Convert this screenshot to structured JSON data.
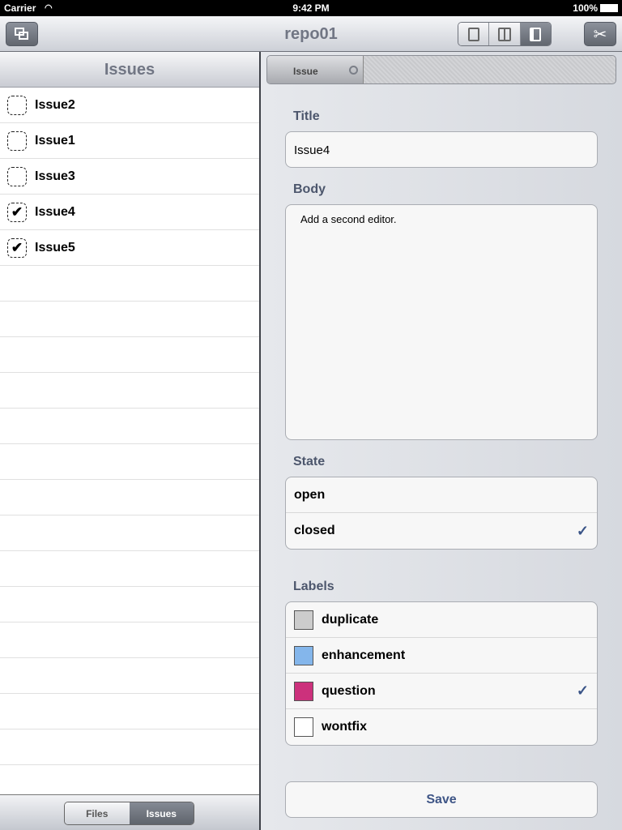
{
  "status": {
    "carrier": "Carrier",
    "time": "9:42 PM",
    "battery": "100%"
  },
  "nav": {
    "title": "repo01"
  },
  "sidebar": {
    "title": "Issues",
    "items": [
      {
        "label": "Issue2",
        "checked": false
      },
      {
        "label": "Issue1",
        "checked": false
      },
      {
        "label": "Issue3",
        "checked": false
      },
      {
        "label": "Issue4",
        "checked": true
      },
      {
        "label": "Issue5",
        "checked": true
      }
    ],
    "tabs": [
      "Files",
      "Issues"
    ],
    "selected_tab": "Issues"
  },
  "detail": {
    "tab": "Issue",
    "title_label": "Title",
    "title_value": "Issue4",
    "body_label": "Body",
    "body_value": "Add a second editor.",
    "state_label": "State",
    "states": [
      {
        "label": "open",
        "checked": false
      },
      {
        "label": "closed",
        "checked": true
      }
    ],
    "labels_label": "Labels",
    "labels": [
      {
        "label": "duplicate",
        "color": "#cccccc",
        "checked": false
      },
      {
        "label": "enhancement",
        "color": "#84b6eb",
        "checked": false
      },
      {
        "label": "question",
        "color": "#cc317c",
        "checked": true
      },
      {
        "label": "wontfix",
        "color": "#ffffff",
        "checked": false
      }
    ],
    "save": "Save"
  }
}
